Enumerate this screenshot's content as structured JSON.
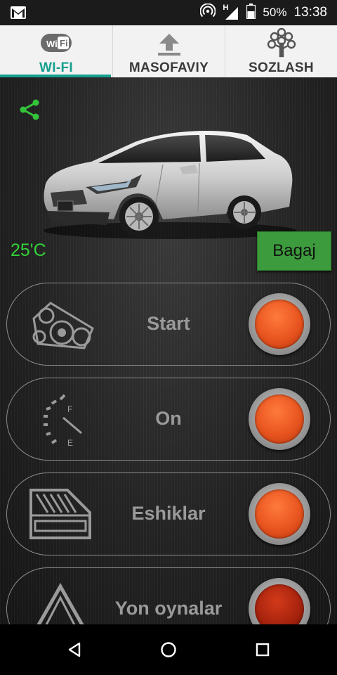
{
  "status_bar": {
    "battery_percent": "50%",
    "time": "13:38",
    "network": "H",
    "icons": [
      "gmail-icon",
      "hotspot-icon",
      "signal-icon",
      "battery-icon"
    ]
  },
  "tabs": [
    {
      "label": "WI-FI",
      "icon": "wifi-icon",
      "active": true
    },
    {
      "label": "MASOFAVIY",
      "icon": "upload-arrow-icon",
      "active": false
    },
    {
      "label": "SOZLASH",
      "icon": "tree-icon",
      "active": false
    }
  ],
  "main": {
    "temperature": "25'C",
    "trunk_button": "Bagaj",
    "controls": [
      {
        "label": "Start",
        "icon": "engine-belt-icon",
        "state": "active"
      },
      {
        "label": "On",
        "icon": "fuel-gauge-icon",
        "state": "active"
      },
      {
        "label": "Eshiklar",
        "icon": "door-icon",
        "state": "active"
      },
      {
        "label": "Yon oynalar",
        "icon": "warning-triangle-icon",
        "state": "dim"
      }
    ]
  },
  "colors": {
    "accent": "#159f8f",
    "temperature_green": "#34d13a",
    "trunk_button_green": "#3c9b3c",
    "action_orange": "#e8541f"
  }
}
